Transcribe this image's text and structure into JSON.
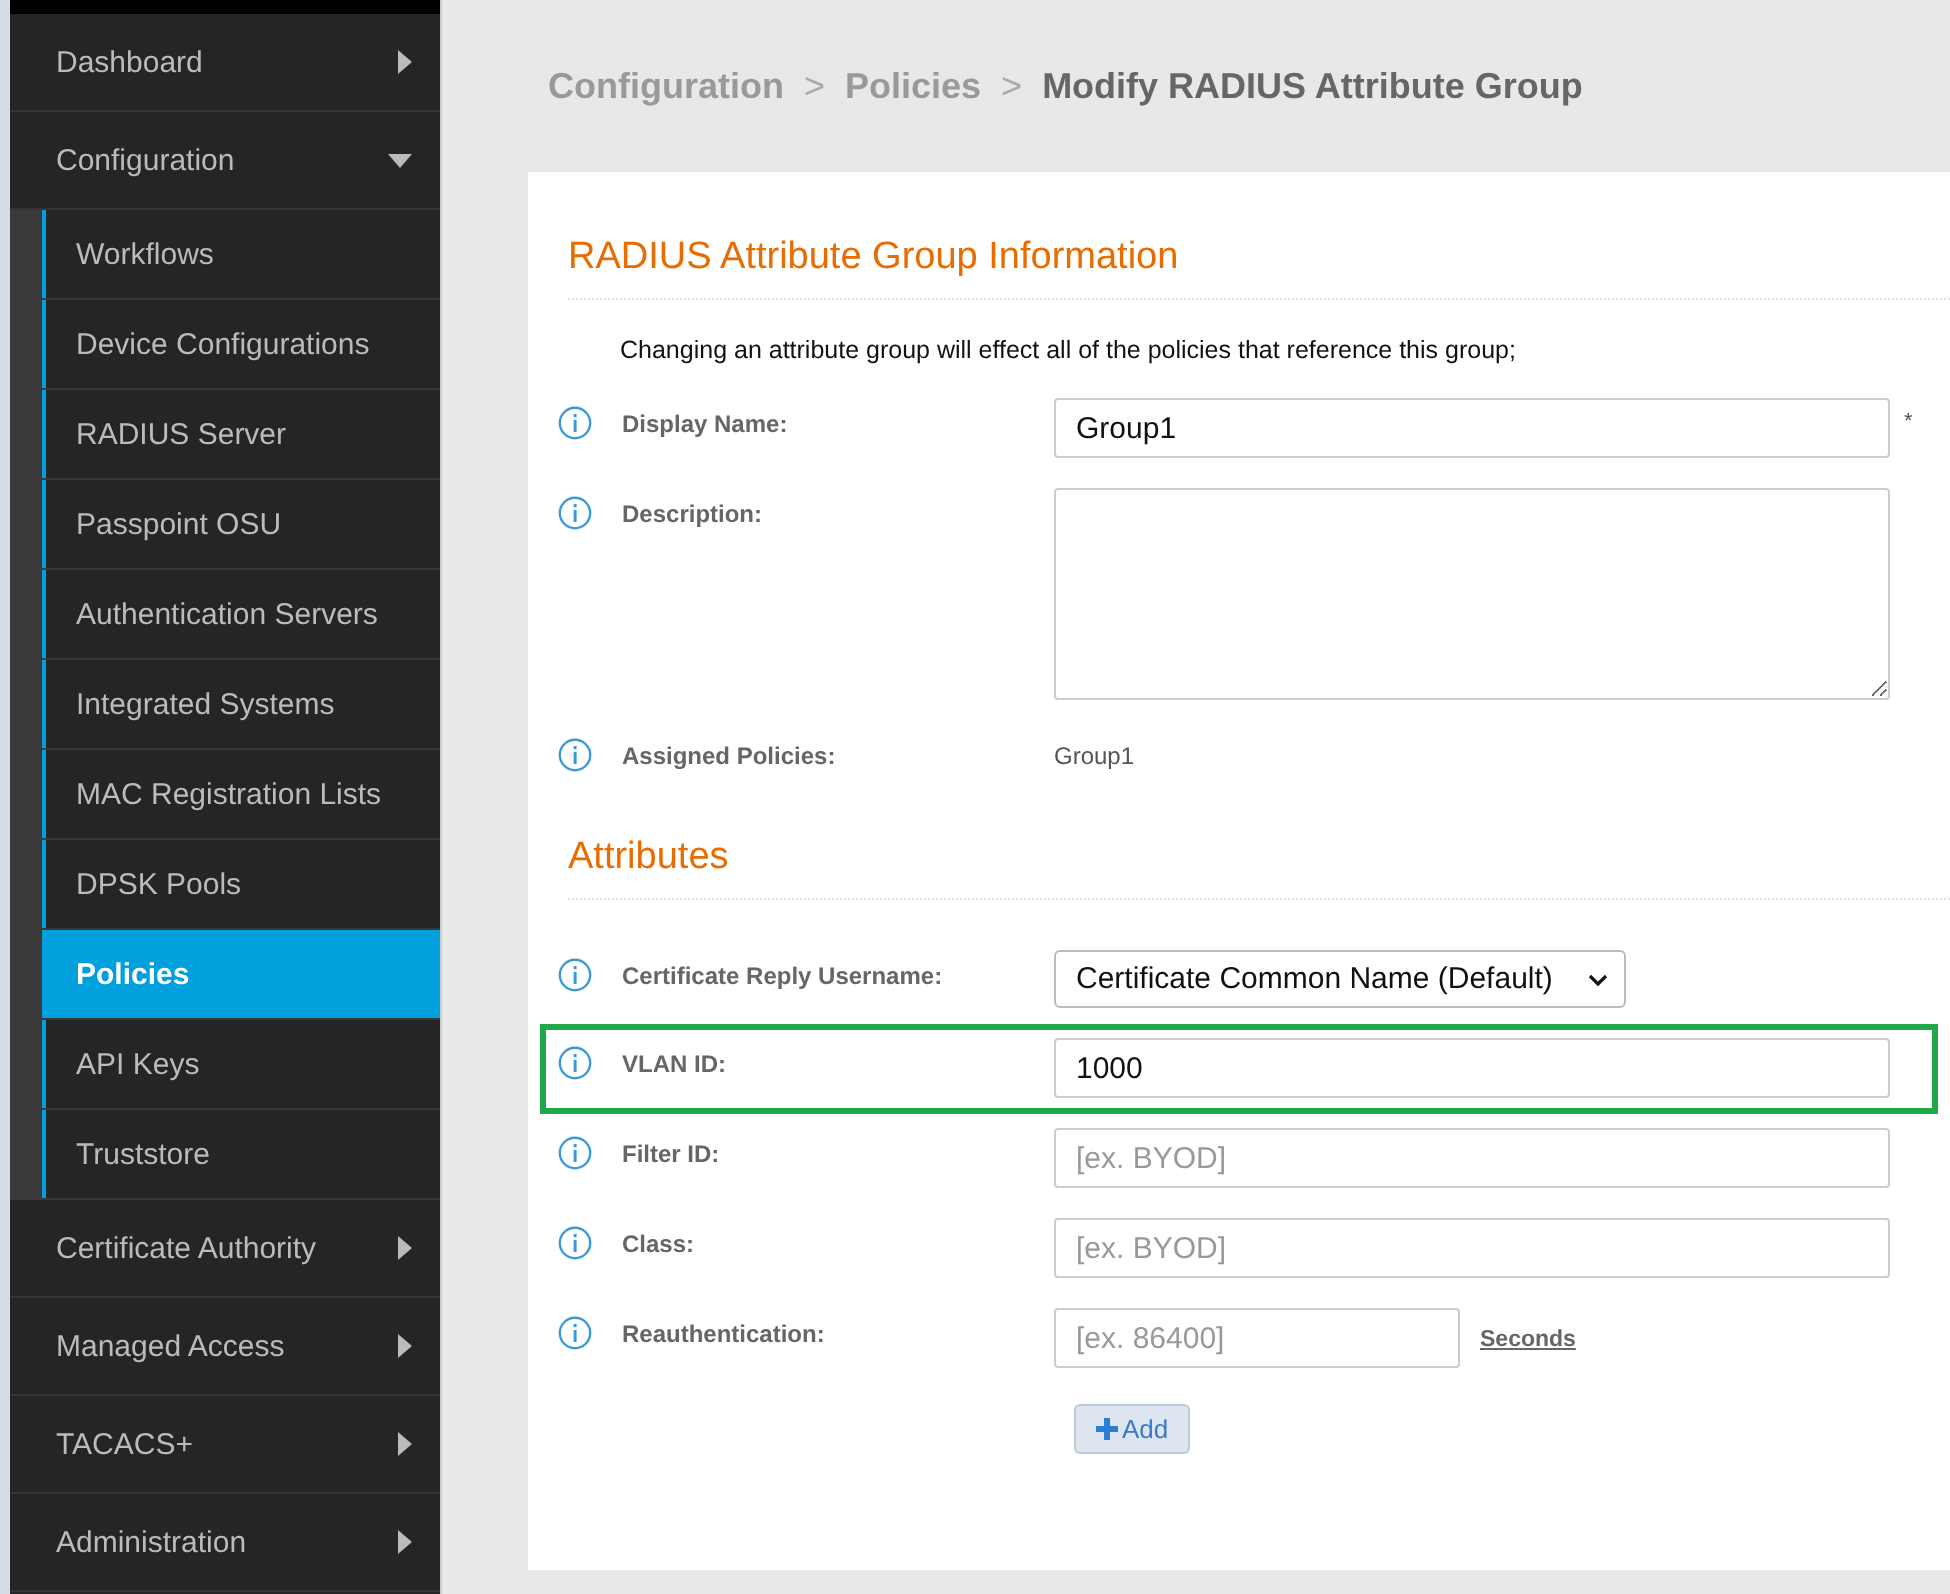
{
  "sidebar": {
    "items": [
      {
        "label": "Dashboard",
        "expanded": false
      },
      {
        "label": "Configuration",
        "expanded": true,
        "children": [
          {
            "label": "Workflows",
            "selected": false
          },
          {
            "label": "Device Configurations",
            "selected": false
          },
          {
            "label": "RADIUS Server",
            "selected": false
          },
          {
            "label": "Passpoint OSU",
            "selected": false
          },
          {
            "label": "Authentication Servers",
            "selected": false
          },
          {
            "label": "Integrated Systems",
            "selected": false
          },
          {
            "label": "MAC Registration Lists",
            "selected": false
          },
          {
            "label": "DPSK Pools",
            "selected": false
          },
          {
            "label": "Policies",
            "selected": true
          },
          {
            "label": "API Keys",
            "selected": false
          },
          {
            "label": "Truststore",
            "selected": false
          }
        ]
      },
      {
        "label": "Certificate Authority",
        "expanded": false
      },
      {
        "label": "Managed Access",
        "expanded": false
      },
      {
        "label": "TACACS+",
        "expanded": false
      },
      {
        "label": "Administration",
        "expanded": false
      }
    ]
  },
  "breadcrumb": [
    {
      "label": "Configuration",
      "current": false
    },
    {
      "label": ">",
      "kind": "sep"
    },
    {
      "label": "Policies",
      "current": false
    },
    {
      "label": ">",
      "kind": "sep"
    },
    {
      "label": "Modify RADIUS Attribute Group",
      "current": true
    }
  ],
  "sections": [
    {
      "title": "RADIUS Attribute Group Information",
      "note": "Changing an attribute group will effect all of the policies that reference this group;",
      "fields": [
        {
          "kind": "text",
          "label": "Display Name:",
          "value": "Group1",
          "required_mark": "*",
          "highlighted": false
        },
        {
          "kind": "textarea",
          "label": "Description:",
          "highlighted": false
        },
        {
          "kind": "static",
          "label": "Assigned Policies:",
          "value": "Group1",
          "highlighted": false
        }
      ]
    },
    {
      "title": "Attributes",
      "fields": [
        {
          "kind": "select",
          "label": "Certificate Reply Username:",
          "value": "Certificate Common Name (Default)",
          "highlighted": false
        },
        {
          "kind": "text",
          "label": "VLAN ID:",
          "value": "1000",
          "highlighted": true
        },
        {
          "kind": "text",
          "label": "Filter ID:",
          "placeholder": "[ex. BYOD]",
          "highlighted": false
        },
        {
          "kind": "text",
          "label": "Class:",
          "placeholder": "[ex. BYOD]",
          "highlighted": false
        },
        {
          "kind": "short",
          "label": "Reauthentication:",
          "placeholder": "[ex. 86400]",
          "unit": "Seconds",
          "highlighted": false
        }
      ]
    }
  ],
  "add_button": "Add"
}
